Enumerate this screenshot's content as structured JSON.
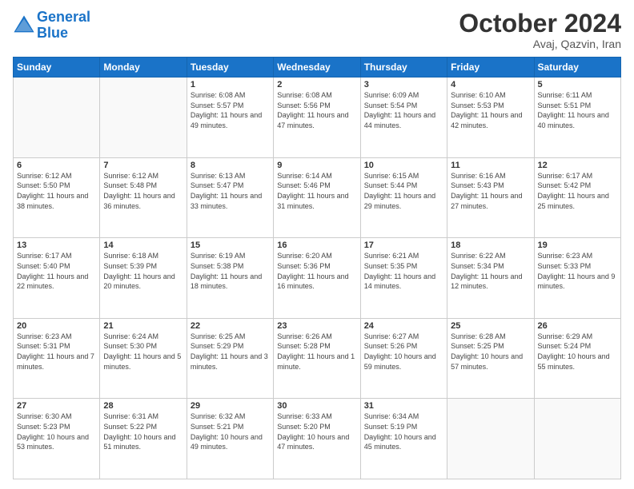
{
  "logo": {
    "line1": "General",
    "line2": "Blue"
  },
  "title": "October 2024",
  "subtitle": "Avaj, Qazvin, Iran",
  "weekdays": [
    "Sunday",
    "Monday",
    "Tuesday",
    "Wednesday",
    "Thursday",
    "Friday",
    "Saturday"
  ],
  "weeks": [
    [
      {
        "day": "",
        "info": ""
      },
      {
        "day": "",
        "info": ""
      },
      {
        "day": "1",
        "info": "Sunrise: 6:08 AM\nSunset: 5:57 PM\nDaylight: 11 hours and 49 minutes."
      },
      {
        "day": "2",
        "info": "Sunrise: 6:08 AM\nSunset: 5:56 PM\nDaylight: 11 hours and 47 minutes."
      },
      {
        "day": "3",
        "info": "Sunrise: 6:09 AM\nSunset: 5:54 PM\nDaylight: 11 hours and 44 minutes."
      },
      {
        "day": "4",
        "info": "Sunrise: 6:10 AM\nSunset: 5:53 PM\nDaylight: 11 hours and 42 minutes."
      },
      {
        "day": "5",
        "info": "Sunrise: 6:11 AM\nSunset: 5:51 PM\nDaylight: 11 hours and 40 minutes."
      }
    ],
    [
      {
        "day": "6",
        "info": "Sunrise: 6:12 AM\nSunset: 5:50 PM\nDaylight: 11 hours and 38 minutes."
      },
      {
        "day": "7",
        "info": "Sunrise: 6:12 AM\nSunset: 5:48 PM\nDaylight: 11 hours and 36 minutes."
      },
      {
        "day": "8",
        "info": "Sunrise: 6:13 AM\nSunset: 5:47 PM\nDaylight: 11 hours and 33 minutes."
      },
      {
        "day": "9",
        "info": "Sunrise: 6:14 AM\nSunset: 5:46 PM\nDaylight: 11 hours and 31 minutes."
      },
      {
        "day": "10",
        "info": "Sunrise: 6:15 AM\nSunset: 5:44 PM\nDaylight: 11 hours and 29 minutes."
      },
      {
        "day": "11",
        "info": "Sunrise: 6:16 AM\nSunset: 5:43 PM\nDaylight: 11 hours and 27 minutes."
      },
      {
        "day": "12",
        "info": "Sunrise: 6:17 AM\nSunset: 5:42 PM\nDaylight: 11 hours and 25 minutes."
      }
    ],
    [
      {
        "day": "13",
        "info": "Sunrise: 6:17 AM\nSunset: 5:40 PM\nDaylight: 11 hours and 22 minutes."
      },
      {
        "day": "14",
        "info": "Sunrise: 6:18 AM\nSunset: 5:39 PM\nDaylight: 11 hours and 20 minutes."
      },
      {
        "day": "15",
        "info": "Sunrise: 6:19 AM\nSunset: 5:38 PM\nDaylight: 11 hours and 18 minutes."
      },
      {
        "day": "16",
        "info": "Sunrise: 6:20 AM\nSunset: 5:36 PM\nDaylight: 11 hours and 16 minutes."
      },
      {
        "day": "17",
        "info": "Sunrise: 6:21 AM\nSunset: 5:35 PM\nDaylight: 11 hours and 14 minutes."
      },
      {
        "day": "18",
        "info": "Sunrise: 6:22 AM\nSunset: 5:34 PM\nDaylight: 11 hours and 12 minutes."
      },
      {
        "day": "19",
        "info": "Sunrise: 6:23 AM\nSunset: 5:33 PM\nDaylight: 11 hours and 9 minutes."
      }
    ],
    [
      {
        "day": "20",
        "info": "Sunrise: 6:23 AM\nSunset: 5:31 PM\nDaylight: 11 hours and 7 minutes."
      },
      {
        "day": "21",
        "info": "Sunrise: 6:24 AM\nSunset: 5:30 PM\nDaylight: 11 hours and 5 minutes."
      },
      {
        "day": "22",
        "info": "Sunrise: 6:25 AM\nSunset: 5:29 PM\nDaylight: 11 hours and 3 minutes."
      },
      {
        "day": "23",
        "info": "Sunrise: 6:26 AM\nSunset: 5:28 PM\nDaylight: 11 hours and 1 minute."
      },
      {
        "day": "24",
        "info": "Sunrise: 6:27 AM\nSunset: 5:26 PM\nDaylight: 10 hours and 59 minutes."
      },
      {
        "day": "25",
        "info": "Sunrise: 6:28 AM\nSunset: 5:25 PM\nDaylight: 10 hours and 57 minutes."
      },
      {
        "day": "26",
        "info": "Sunrise: 6:29 AM\nSunset: 5:24 PM\nDaylight: 10 hours and 55 minutes."
      }
    ],
    [
      {
        "day": "27",
        "info": "Sunrise: 6:30 AM\nSunset: 5:23 PM\nDaylight: 10 hours and 53 minutes."
      },
      {
        "day": "28",
        "info": "Sunrise: 6:31 AM\nSunset: 5:22 PM\nDaylight: 10 hours and 51 minutes."
      },
      {
        "day": "29",
        "info": "Sunrise: 6:32 AM\nSunset: 5:21 PM\nDaylight: 10 hours and 49 minutes."
      },
      {
        "day": "30",
        "info": "Sunrise: 6:33 AM\nSunset: 5:20 PM\nDaylight: 10 hours and 47 minutes."
      },
      {
        "day": "31",
        "info": "Sunrise: 6:34 AM\nSunset: 5:19 PM\nDaylight: 10 hours and 45 minutes."
      },
      {
        "day": "",
        "info": ""
      },
      {
        "day": "",
        "info": ""
      }
    ]
  ]
}
